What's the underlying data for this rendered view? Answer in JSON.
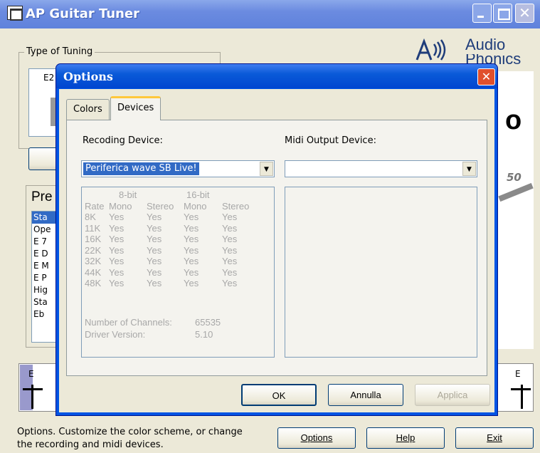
{
  "window": {
    "title": "AP Guitar Tuner"
  },
  "main": {
    "tuning_group_label": "Type of Tuning",
    "tuning_value_partial": "E2",
    "presets_label_partial": "Pre",
    "presets_items_partial": [
      "Sta",
      "Ope",
      "E 7",
      "E D",
      "E M",
      "E P",
      "Hig",
      "Sta",
      "Eb"
    ],
    "logo_line1": "Audio",
    "logo_line2": "Phonics",
    "gauge_number_partial": "50",
    "big_char_partial": "o",
    "string_left_note": "E",
    "string_right_note": "E"
  },
  "status": {
    "line1": "Options.  Customize the color scheme, or change",
    "line2": "the recording and midi devices."
  },
  "bottom_buttons": {
    "options": "Options",
    "help": "Help",
    "exit": "Exit"
  },
  "dialog": {
    "title": "Options",
    "tabs": {
      "colors": "Colors",
      "devices": "Devices"
    },
    "recording_label": "Recoding Device:",
    "recording_selected": "Periferica wave SB Live!",
    "midi_label": "Midi Output Device:",
    "midi_selected": "",
    "caps": {
      "head_8bit": "8-bit",
      "head_16bit": "16-bit",
      "col_rate": "Rate",
      "col_mono1": "Mono",
      "col_stereo1": "Stereo",
      "col_mono2": "Mono",
      "col_stereo2": "Stereo",
      "rows": [
        {
          "rate": "8K",
          "v": [
            "Yes",
            "Yes",
            "Yes",
            "Yes"
          ]
        },
        {
          "rate": "11K",
          "v": [
            "Yes",
            "Yes",
            "Yes",
            "Yes"
          ]
        },
        {
          "rate": "16K",
          "v": [
            "Yes",
            "Yes",
            "Yes",
            "Yes"
          ]
        },
        {
          "rate": "22K",
          "v": [
            "Yes",
            "Yes",
            "Yes",
            "Yes"
          ]
        },
        {
          "rate": "32K",
          "v": [
            "Yes",
            "Yes",
            "Yes",
            "Yes"
          ]
        },
        {
          "rate": "44K",
          "v": [
            "Yes",
            "Yes",
            "Yes",
            "Yes"
          ]
        },
        {
          "rate": "48K",
          "v": [
            "Yes",
            "Yes",
            "Yes",
            "Yes"
          ]
        }
      ],
      "channels_label": "Number of Channels:",
      "channels_value": "65535",
      "driver_label": "Driver Version:",
      "driver_value": "5.10"
    },
    "buttons": {
      "ok": "OK",
      "cancel": "Annulla",
      "apply": "Applica"
    }
  }
}
